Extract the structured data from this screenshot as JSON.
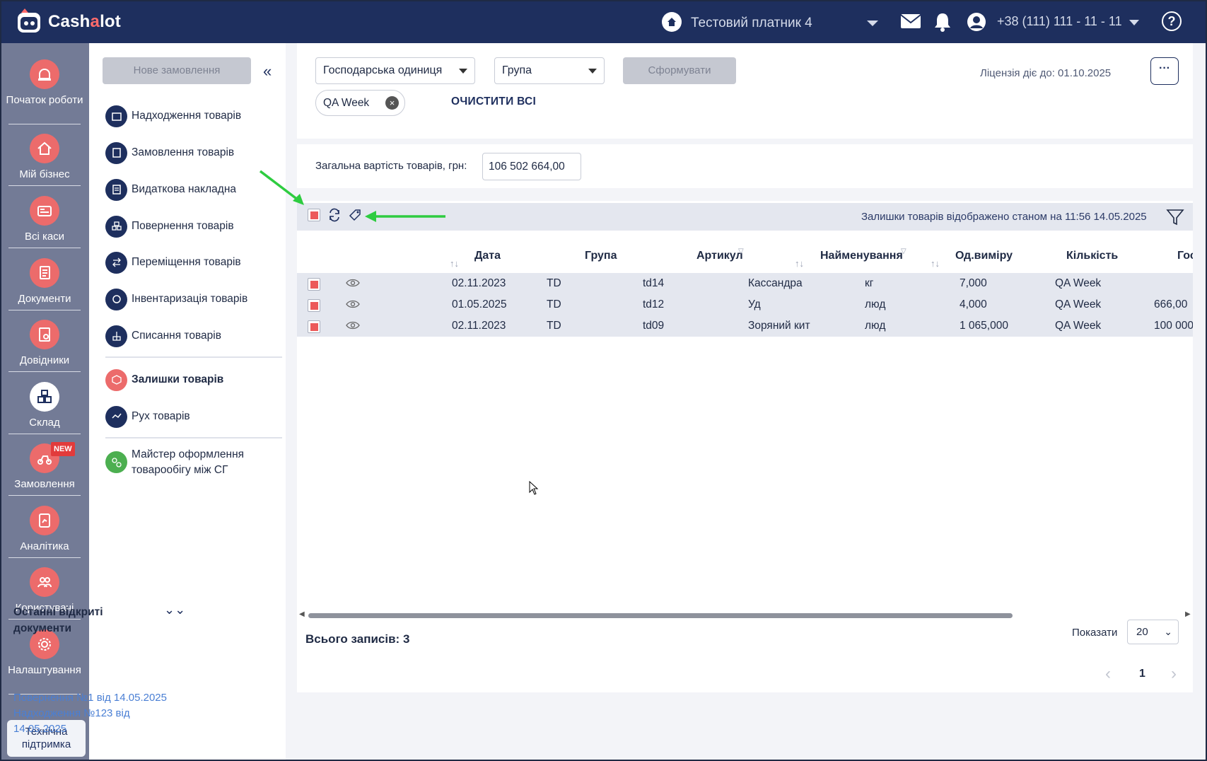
{
  "app": {
    "logo_text_1": "Cash",
    "logo_text_2": "a",
    "logo_text_3": "lot"
  },
  "header": {
    "taxpayer": "Тестовий платник 4",
    "phone": "+38 (111) 111 - 11 - 11",
    "help": "?"
  },
  "rail": {
    "items": [
      {
        "label": "Початок роботи",
        "icon": "alarm-icon"
      },
      {
        "label": "Мій бізнес",
        "icon": "home-icon"
      },
      {
        "label": "Всі каси",
        "icon": "cash-register-icon"
      },
      {
        "label": "Документи",
        "icon": "documents-icon"
      },
      {
        "label": "Довідники",
        "icon": "directory-icon"
      },
      {
        "label": "Склад",
        "icon": "warehouse-icon"
      },
      {
        "label": "Замовлення",
        "icon": "delivery-icon"
      },
      {
        "label": "Аналітика",
        "icon": "analytics-icon"
      },
      {
        "label": "Користувачі",
        "icon": "users-icon"
      },
      {
        "label": "Налаштування",
        "icon": "gear-icon"
      }
    ],
    "new_badge": "NEW",
    "support": "Технічна підтримка"
  },
  "sidebar": {
    "new_order": "Нове замовлення",
    "items": [
      {
        "label": "Надходження товарів"
      },
      {
        "label": "Замовлення товарів"
      },
      {
        "label": "Видаткова накладна"
      },
      {
        "label": "Повернення товарів"
      },
      {
        "label": "Переміщення товарів"
      },
      {
        "label": "Інвентаризація товарів"
      },
      {
        "label": "Списання товарів"
      },
      {
        "label": "Залишки товарів"
      },
      {
        "label": "Рух товарів"
      },
      {
        "label": "Майстер оформлення товарообігу між СГ"
      }
    ],
    "recent_title": "Останні відкриті документи",
    "recent_links": [
      "Повернення №1 від 14.05.2025",
      "Надходження №123 від 14.05.2025"
    ]
  },
  "filters": {
    "business_unit": "Господарська одиниця",
    "group": "Група",
    "form_button": "Сформувати",
    "license": "Ліцензія діє до: 01.10.2025",
    "more": "···",
    "chip": "QA Week",
    "clear_all": "ОЧИСТИТИ ВСІ"
  },
  "totals": {
    "label": "Загальна вартість товарів, грн:",
    "value": "106 502 664,00"
  },
  "table": {
    "snapshot": "Залишки товарів відображено станом на 11:56 14.05.2025",
    "columns": [
      "Дата",
      "Група",
      "Артикул",
      "Найменування",
      "Од.виміру",
      "Кількість",
      "Гос"
    ],
    "rows": [
      {
        "date": "02.11.2023",
        "group": "TD",
        "sku": "td14",
        "name": "Кассандра",
        "unit": "кг",
        "qty": "7,000",
        "owner": "QA Week",
        "extra": ""
      },
      {
        "date": "01.05.2025",
        "group": "TD",
        "sku": "td12",
        "name": "Уд",
        "unit": "люд",
        "qty": "4,000",
        "owner": "QA Week",
        "extra": "666,00"
      },
      {
        "date": "02.11.2023",
        "group": "TD",
        "sku": "td09",
        "name": "Зоряний кит",
        "unit": "люд",
        "qty": "1 065,000",
        "owner": "QA Week",
        "extra": "100 000"
      }
    ],
    "records": "Всього записів: 3",
    "show_label": "Показати",
    "page_size": "20",
    "page": "1"
  },
  "colors": {
    "header": "#1e2f5e",
    "rail": "#737b96",
    "accent": "#ec6b6b",
    "annotation_arrow": "#2ecc40"
  }
}
